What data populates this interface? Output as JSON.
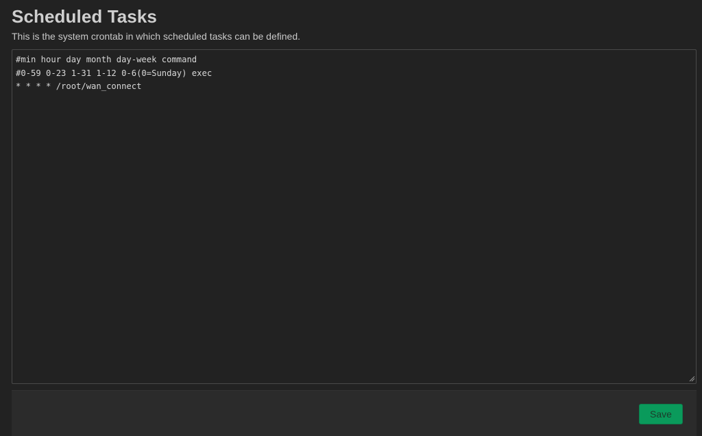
{
  "header": {
    "title": "Scheduled Tasks",
    "description": "This is the system crontab in which scheduled tasks can be defined."
  },
  "editor": {
    "content": "#min hour day month day-week command\n#0-59 0-23 1-31 1-12 0-6(0=Sunday) exec\n* * * * /root/wan_connect"
  },
  "actions": {
    "save_label": "Save"
  },
  "colors": {
    "background": "#222222",
    "panel": "#2b2b2b",
    "accent": "#0a9a5b",
    "text": "#cfcfcf"
  }
}
